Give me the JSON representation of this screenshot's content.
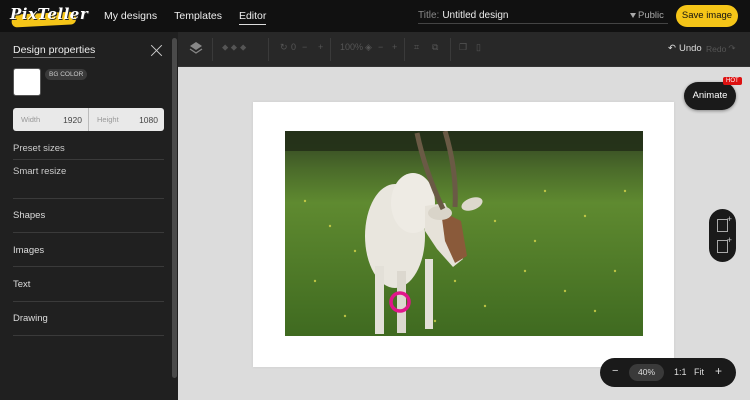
{
  "app": {
    "logo_text": "PixTeller",
    "brand_color": "#f5c518"
  },
  "nav": {
    "items": [
      "My designs",
      "Templates",
      "Editor"
    ],
    "active": "Editor"
  },
  "title": {
    "label": "Title:",
    "value": "Untitled design"
  },
  "visibility": "Public",
  "save_label": "Save image",
  "sidebar": {
    "title": "Design properties",
    "bg_color_label": "BG COLOR",
    "bg_color_value": "#ffffff",
    "width_label": "Width",
    "width_value": "1920",
    "height_label": "Height",
    "height_value": "1080",
    "links": [
      "Preset sizes",
      "Smart resize"
    ],
    "sections": [
      "Shapes",
      "Images",
      "Text",
      "Drawing"
    ]
  },
  "toolbar": {
    "zoom_text": "100%",
    "undo_label": "Undo",
    "redo_label": "Redo"
  },
  "workspace": {
    "animate_label": "Animate",
    "hot_badge": "HOT"
  },
  "zoom": {
    "value": "40%",
    "ratio_label": "1:1",
    "fit_label": "Fit"
  }
}
